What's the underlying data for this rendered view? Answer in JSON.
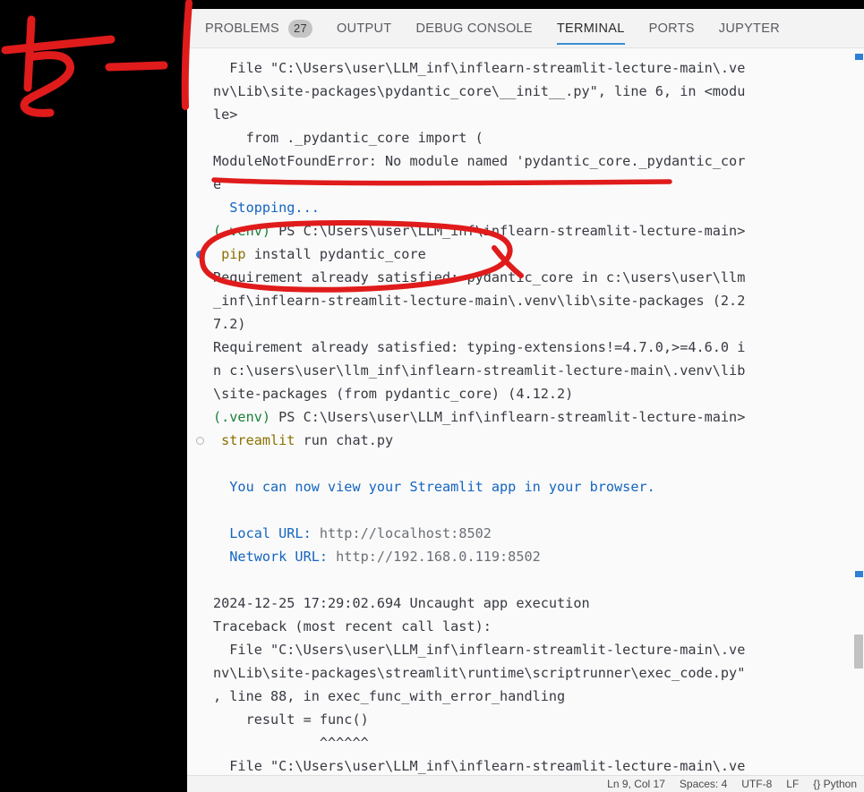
{
  "window": {
    "app": "Visual Studio Code",
    "accent_color": "#3b8ed0",
    "annotation_color": "#e01b1b",
    "terminal_background": "#fafafa",
    "gutter_background": "#000000"
  },
  "panel_tabs": [
    {
      "label": "PROBLEMS",
      "badge": "27",
      "active": false
    },
    {
      "label": "OUTPUT",
      "badge": "",
      "active": false
    },
    {
      "label": "DEBUG CONSOLE",
      "badge": "",
      "active": false
    },
    {
      "label": "TERMINAL",
      "badge": "",
      "active": true
    },
    {
      "label": "PORTS",
      "badge": "",
      "active": false
    },
    {
      "label": "JUPYTER",
      "badge": "",
      "active": false
    }
  ],
  "terminal": {
    "lines": [
      {
        "deco": "",
        "segments": [
          {
            "t": "  File \"C:\\Users\\user\\LLM_inf\\inflearn-streamlit-lecture-main\\.ve",
            "c": "c-default"
          }
        ]
      },
      {
        "deco": "",
        "segments": [
          {
            "t": "nv\\Lib\\site-packages\\pydantic_core\\__init__.py\", line 6, in <modu",
            "c": "c-default"
          }
        ]
      },
      {
        "deco": "",
        "segments": [
          {
            "t": "le>",
            "c": "c-default"
          }
        ]
      },
      {
        "deco": "",
        "segments": [
          {
            "t": "    from ._pydantic_core import (",
            "c": "c-default"
          }
        ]
      },
      {
        "deco": "",
        "segments": [
          {
            "t": "ModuleNotFoundError: No module named 'pydantic_core._pydantic_cor",
            "c": "c-default"
          }
        ]
      },
      {
        "deco": "",
        "segments": [
          {
            "t": "e'",
            "c": "c-default"
          }
        ]
      },
      {
        "deco": "",
        "segments": [
          {
            "t": "  Stopping...",
            "c": "c-blue"
          }
        ]
      },
      {
        "deco": "",
        "segments": [
          {
            "t": "(.venv)",
            "c": "c-green"
          },
          {
            "t": " PS C:\\Users\\user\\LLM_inf\\inflearn-streamlit-lecture-main>",
            "c": "c-default"
          }
        ]
      },
      {
        "deco": "dot-blue",
        "segments": [
          {
            "t": " pip",
            "c": "c-yellow"
          },
          {
            "t": " install pydantic_core",
            "c": "c-default"
          }
        ]
      },
      {
        "deco": "",
        "segments": [
          {
            "t": "Requirement already satisfied: pydantic_core in c:\\users\\user\\llm",
            "c": "c-default"
          }
        ]
      },
      {
        "deco": "",
        "segments": [
          {
            "t": "_inf\\inflearn-streamlit-lecture-main\\.venv\\lib\\site-packages (2.2",
            "c": "c-default"
          }
        ]
      },
      {
        "deco": "",
        "segments": [
          {
            "t": "7.2)",
            "c": "c-default"
          }
        ]
      },
      {
        "deco": "",
        "segments": [
          {
            "t": "Requirement already satisfied: typing-extensions!=4.7.0,>=4.6.0 i",
            "c": "c-default"
          }
        ]
      },
      {
        "deco": "",
        "segments": [
          {
            "t": "n c:\\users\\user\\llm_inf\\inflearn-streamlit-lecture-main\\.venv\\lib",
            "c": "c-default"
          }
        ]
      },
      {
        "deco": "",
        "segments": [
          {
            "t": "\\site-packages (from pydantic_core) (4.12.2)",
            "c": "c-default"
          }
        ]
      },
      {
        "deco": "",
        "segments": [
          {
            "t": "(.venv)",
            "c": "c-green"
          },
          {
            "t": " PS C:\\Users\\user\\LLM_inf\\inflearn-streamlit-lecture-main>",
            "c": "c-default"
          }
        ]
      },
      {
        "deco": "dot-ring",
        "segments": [
          {
            "t": " streamlit",
            "c": "c-yellow"
          },
          {
            "t": " run chat.py",
            "c": "c-default"
          }
        ]
      },
      {
        "deco": "",
        "segments": [
          {
            "t": "",
            "c": "c-default"
          }
        ]
      },
      {
        "deco": "",
        "segments": [
          {
            "t": "  You can now view your Streamlit app in your browser.",
            "c": "c-blue"
          }
        ]
      },
      {
        "deco": "",
        "segments": [
          {
            "t": "",
            "c": "c-default"
          }
        ]
      },
      {
        "deco": "",
        "segments": [
          {
            "t": "  Local URL: ",
            "c": "c-blue"
          },
          {
            "t": "http://localhost:8502",
            "c": "c-gray"
          }
        ]
      },
      {
        "deco": "",
        "segments": [
          {
            "t": "  Network URL: ",
            "c": "c-blue"
          },
          {
            "t": "http://192.168.0.119:8502",
            "c": "c-gray"
          }
        ]
      },
      {
        "deco": "",
        "segments": [
          {
            "t": "",
            "c": "c-default"
          }
        ]
      },
      {
        "deco": "",
        "segments": [
          {
            "t": "2024-12-25 17:29:02.694 Uncaught app execution",
            "c": "c-default"
          }
        ]
      },
      {
        "deco": "",
        "segments": [
          {
            "t": "Traceback (most recent call last):",
            "c": "c-default"
          }
        ]
      },
      {
        "deco": "",
        "segments": [
          {
            "t": "  File \"C:\\Users\\user\\LLM_inf\\inflearn-streamlit-lecture-main\\.ve",
            "c": "c-default"
          }
        ]
      },
      {
        "deco": "",
        "segments": [
          {
            "t": "nv\\Lib\\site-packages\\streamlit\\runtime\\scriptrunner\\exec_code.py\"",
            "c": "c-default"
          }
        ]
      },
      {
        "deco": "",
        "segments": [
          {
            "t": ", line 88, in exec_func_with_error_handling",
            "c": "c-default"
          }
        ]
      },
      {
        "deco": "",
        "segments": [
          {
            "t": "    result = func()",
            "c": "c-default"
          }
        ]
      },
      {
        "deco": "",
        "segments": [
          {
            "t": "             ^^^^^^",
            "c": "c-default"
          }
        ]
      },
      {
        "deco": "",
        "segments": [
          {
            "t": "  File \"C:\\Users\\user\\LLM_inf\\inflearn-streamlit-lecture-main\\.ve",
            "c": "c-default"
          }
        ]
      }
    ]
  },
  "statusbar": {
    "items": [
      "Ln 9, Col 17",
      "Spaces: 4",
      "UTF-8",
      "LF",
      "{} Python"
    ]
  },
  "annotations": {
    "underline_module_error": "red underline under ModuleNotFoundError line",
    "ellipse_pip_install": "red ellipse around pip install pydantic_core",
    "handwritten_mark": "red handwritten stroke in left black margin",
    "vertical_stroke": "red vertical stroke at panel left edge"
  }
}
